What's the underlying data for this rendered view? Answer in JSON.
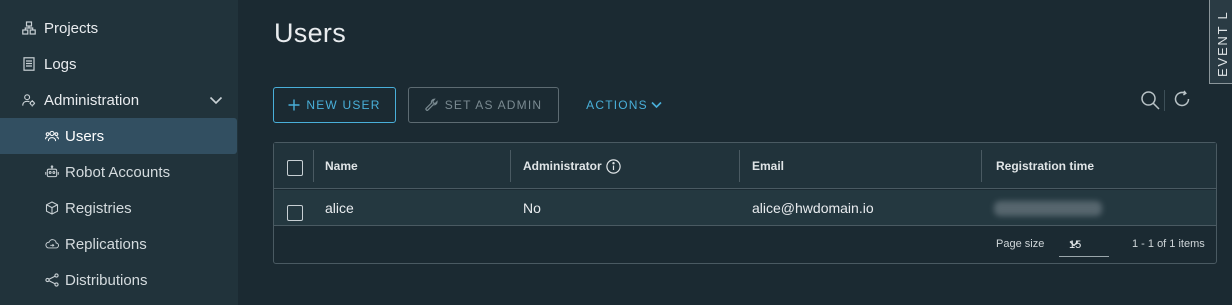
{
  "sidebar": {
    "projects": "Projects",
    "logs": "Logs",
    "administration": "Administration",
    "items": [
      {
        "label": "Users",
        "icon": "users-icon"
      },
      {
        "label": "Robot Accounts",
        "icon": "robot-icon"
      },
      {
        "label": "Registries",
        "icon": "cube-icon"
      },
      {
        "label": "Replications",
        "icon": "cloud-icon"
      },
      {
        "label": "Distributions",
        "icon": "share-icon"
      }
    ]
  },
  "page": {
    "title": "Users"
  },
  "toolbar": {
    "new_user": "NEW USER",
    "set_as_admin": "SET AS ADMIN",
    "actions": "ACTIONS"
  },
  "event_log": "EVENT L",
  "table": {
    "columns": [
      "Name",
      "Administrator",
      "Email",
      "Registration time"
    ],
    "rows": [
      {
        "name": "alice",
        "administrator": "No",
        "email": "alice@hwdomain.io"
      }
    ],
    "page_size_label": "Page size",
    "page_size": "15",
    "count": "1 - 1 of 1 items"
  },
  "colors": {
    "background": "#1b2a32",
    "sidebar": "#21333b",
    "active_item": "#324f61",
    "accent": "#49afd9"
  }
}
